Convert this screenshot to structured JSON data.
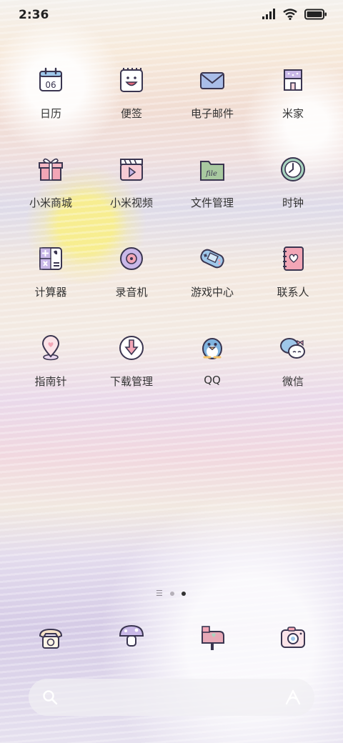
{
  "status": {
    "time": "2:36"
  },
  "apps": [
    {
      "label": "日历",
      "icon": "calendar-icon",
      "date": "06"
    },
    {
      "label": "便签",
      "icon": "notes-icon"
    },
    {
      "label": "电子邮件",
      "icon": "email-icon"
    },
    {
      "label": "米家",
      "icon": "mi-home-icon"
    },
    {
      "label": "小米商城",
      "icon": "gift-box-icon"
    },
    {
      "label": "小米视频",
      "icon": "video-icon"
    },
    {
      "label": "文件管理",
      "icon": "folder-icon",
      "folder_text": "file"
    },
    {
      "label": "时钟",
      "icon": "clock-icon"
    },
    {
      "label": "计算器",
      "icon": "calculator-icon"
    },
    {
      "label": "录音机",
      "icon": "recorder-icon"
    },
    {
      "label": "游戏中心",
      "icon": "gamepad-icon"
    },
    {
      "label": "联系人",
      "icon": "contacts-book-icon"
    },
    {
      "label": "指南针",
      "icon": "location-pin-icon"
    },
    {
      "label": "下载管理",
      "icon": "download-icon"
    },
    {
      "label": "QQ",
      "icon": "penguin-icon"
    },
    {
      "label": "微信",
      "icon": "chat-bubbles-icon"
    }
  ],
  "dock": [
    "phone-icon",
    "mushroom-browser-icon",
    "mailbox-icon",
    "camera-icon"
  ],
  "page_indicator": {
    "pages": 3,
    "active": 2
  },
  "colors": {
    "icon_stroke": "#3a3550",
    "pink": "#f2a6b6",
    "lavender": "#c9b8e8",
    "mint": "#a8d5c0",
    "blue": "#9ec7ea"
  }
}
